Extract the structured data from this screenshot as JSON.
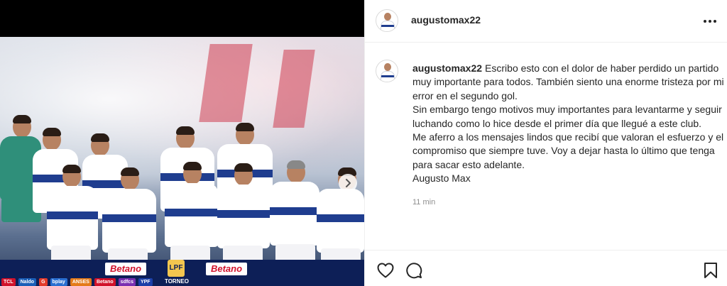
{
  "post": {
    "username": "augustomax22",
    "caption_paragraphs": [
      "Escribo esto con el dolor de haber perdido un partido muy importante para todos. También siento una enorme tristeza por mi error en el segundo gol.",
      "Sin embargo tengo motivos muy importantes para levantarme y seguir luchando como lo hice desde el primer día que llegué a este club.",
      "Me aferro a los mensajes lindos que recibí que valoran el esfuerzo y el compromiso que siempre tuve. Voy a dejar hasta lo último que tenga para sacar esto adelante.",
      "Augusto Max"
    ],
    "time_ago": "11 min"
  },
  "media": {
    "ad_brands": [
      "Betano",
      "Betano"
    ],
    "league_badge": "LPF",
    "league_text": "TORNEO",
    "sponsor_strip": [
      "TCL",
      "Naldo",
      "G",
      "bplay",
      "ANSES",
      "Betano",
      "sdfcs",
      "YPF"
    ]
  },
  "icons": {
    "more": "more-options-icon",
    "like": "heart-icon",
    "comment": "comment-icon",
    "save": "bookmark-icon",
    "next": "chevron-right-icon"
  },
  "colors": {
    "text": "#262626",
    "muted": "#8e8e8e",
    "border": "#efefef"
  }
}
